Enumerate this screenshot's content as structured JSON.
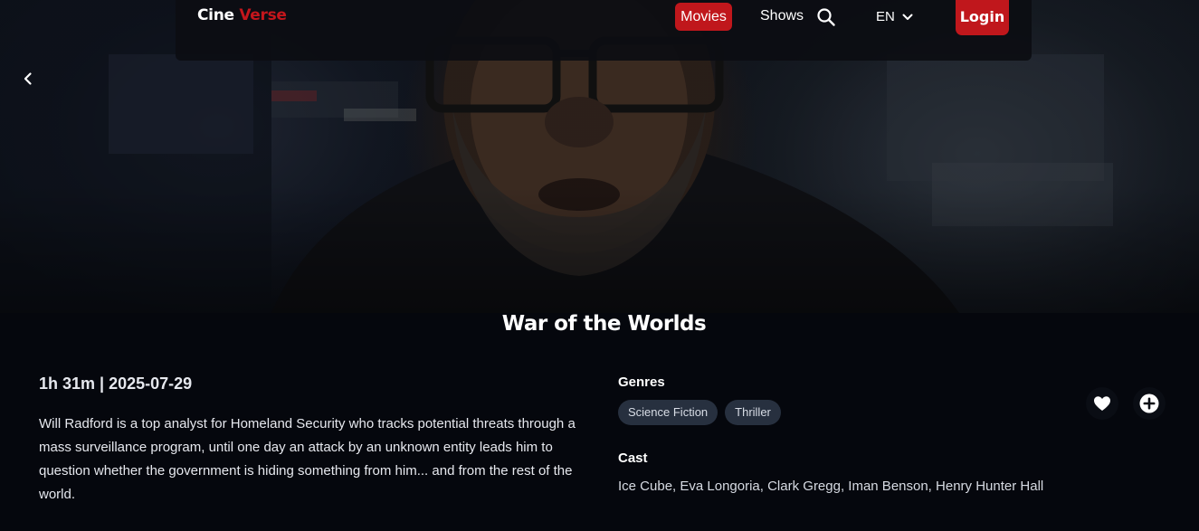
{
  "navbar": {
    "logo_first": "Cine",
    "logo_second": "Verse",
    "movies_label": "Movies",
    "shows_label": "Shows",
    "language": "EN",
    "login_label": "Login",
    "icons": [
      "search-icon",
      "chevron-down-icon",
      "chevron-left-icon"
    ]
  },
  "movie": {
    "title": "War of the Worlds",
    "meta": "1h 31m | 2025-07-29",
    "overview": "Will Radford is a top analyst for Homeland Security who tracks potential threats through a mass surveillance program, until one day an attack by an unknown entity leads him to question whether the government is hiding something from him... and from the rest of the world.",
    "genres_heading": "Genres",
    "genres": [
      "Science Fiction",
      "Thriller"
    ],
    "cast_heading": "Cast",
    "cast": "Ice Cube, Eva Longoria, Clark Gregg, Iman Benson, Henry Hunter Hall"
  },
  "actions": {
    "icons": [
      "heart-icon",
      "plus-circle-icon"
    ]
  },
  "colors": {
    "accent": "#c0171c",
    "background": "#05070d",
    "chip": "#27303f"
  }
}
